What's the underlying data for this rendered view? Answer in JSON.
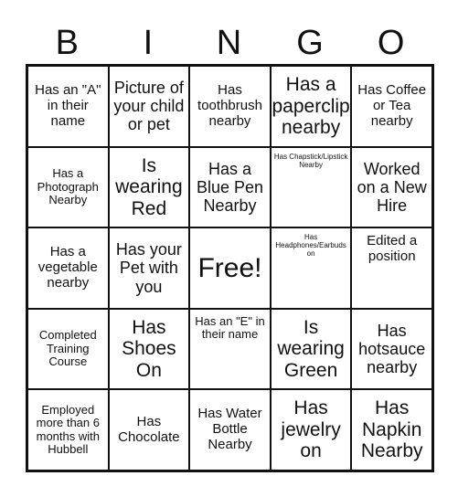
{
  "header": [
    "B",
    "I",
    "N",
    "G",
    "O"
  ],
  "cells": [
    "Has an \"A\" in their name",
    "Picture of your child or pet",
    "Has toothbrush nearby",
    "Has a paperclip nearby",
    "Has Coffee or Tea nearby",
    "Has a Photograph Nearby",
    "Is wearing Red",
    "Has a Blue Pen Nearby",
    "Has Chapstick/Lipstick Nearby",
    "Worked on a New Hire",
    "Has a vegetable nearby",
    "Has your Pet with you",
    "Free!",
    "Has Headphones/Earbuds on",
    "Edited a position",
    "Completed Training Course",
    "Has Shoes On",
    "Has an \"E\" in their name",
    "Is wearing Green",
    "Has hotsauce nearby",
    "Employed more than 6 months with Hubbell",
    "Has Chocolate",
    "Has Water Bottle Nearby",
    "Has jewelry on",
    "Has Napkin Nearby"
  ]
}
